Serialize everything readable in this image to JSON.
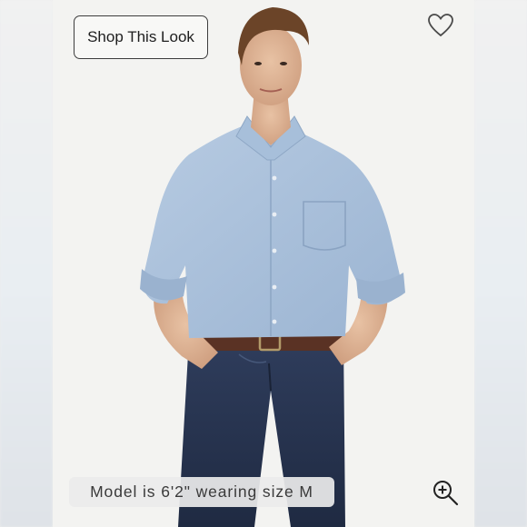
{
  "shop_button": {
    "label": "Shop This Look"
  },
  "favorite": {
    "icon": "heart-outline-icon"
  },
  "caption": {
    "text": "Model is 6'2\" wearing size M"
  },
  "zoom": {
    "icon": "zoom-in-icon"
  },
  "colors": {
    "shirt": "#a9c0da",
    "jeans": "#283550",
    "belt": "#5a3224",
    "background": "#f3f3f1"
  }
}
